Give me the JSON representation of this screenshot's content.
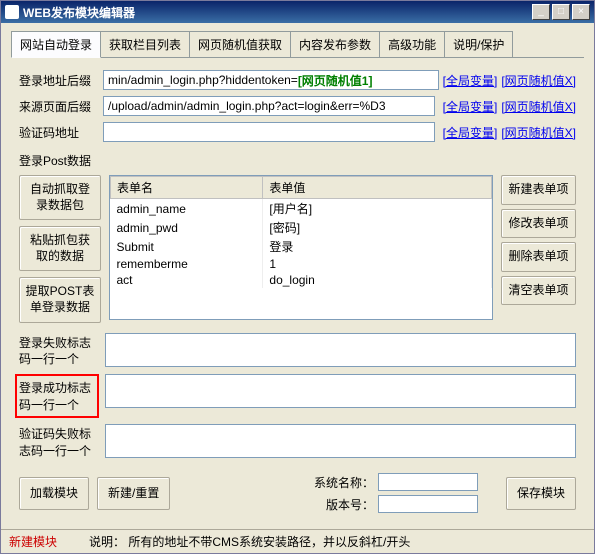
{
  "window": {
    "title": "WEB发布模块编辑器",
    "controls": {
      "min": "_",
      "max": "□",
      "close": "×"
    }
  },
  "tabs": [
    "网站自动登录",
    "获取栏目列表",
    "网页随机值获取",
    "内容发布参数",
    "高级功能",
    "说明/保护"
  ],
  "labels": {
    "login_url_suffix": "登录地址后缀",
    "referer_suffix": "来源页面后缀",
    "captcha_url": "验证码地址",
    "post_data": "登录Post数据",
    "fail_flag": "登录失败标志\n码一行一个",
    "success_flag": "登录成功标志\n码一行一个",
    "captcha_fail": "验证码失败标\n志码一行一个",
    "system_name": "系统名称：",
    "version": "版本号："
  },
  "inputs": {
    "login_url": "min/admin_login.php?hiddentoken=",
    "login_url_tag": "[网页随机值1]",
    "referer": "/upload/admin/admin_login.php?act=login&err=%D3",
    "captcha": "",
    "fail": "",
    "success": "",
    "captcha_fail": "",
    "sys_name": "",
    "version": ""
  },
  "links": {
    "global_var": "[全局变量]",
    "random_val": "[网页随机值X]"
  },
  "table": {
    "headers": [
      "表单名",
      "表单值"
    ],
    "rows": [
      [
        "admin_name",
        "[用户名]"
      ],
      [
        "admin_pwd",
        "[密码]"
      ],
      [
        "Submit",
        "登录"
      ],
      [
        "rememberme",
        "1"
      ],
      [
        "act",
        "do_login"
      ]
    ]
  },
  "left_buttons": [
    "自动抓取登\n录数据包",
    "粘贴抓包获\n取的数据",
    "提取POST表\n单登录数据"
  ],
  "right_buttons": [
    "新建表单项",
    "修改表单项",
    "删除表单项",
    "清空表单项"
  ],
  "bottom_buttons": {
    "load": "加载模块",
    "new": "新建/重置",
    "save": "保存模块"
  },
  "status": {
    "new_module": "新建模块",
    "note": "说明：  所有的地址不带CMS系统安装路径，并以反斜杠/开头"
  }
}
